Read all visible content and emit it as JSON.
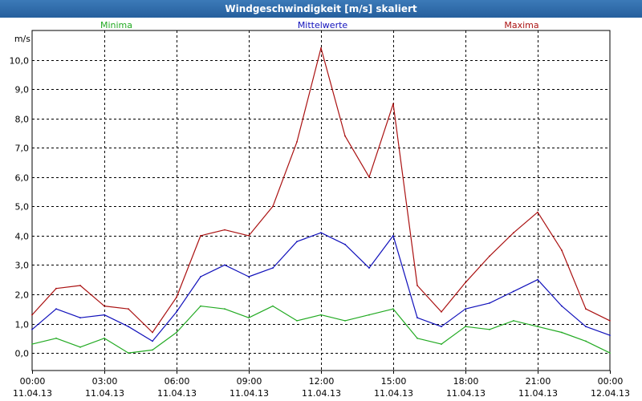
{
  "window": {
    "title": "Windgeschwindigkeit [m/s] skaliert"
  },
  "colors": {
    "minima": "#22aa22",
    "mittelwerte": "#1111bb",
    "maxima": "#aa1111",
    "grid": "#000000",
    "background": "#ffffff",
    "titlebar": "#2f6ca8"
  },
  "chart_data": {
    "type": "line",
    "title": "Windgeschwindigkeit [m/s] skaliert",
    "ylabel": "m/s",
    "xlabel": "",
    "ylim": [
      -0.6,
      11.0
    ],
    "xlim": [
      0,
      24
    ],
    "grid": true,
    "legend_position": "top",
    "yticks": [
      0.0,
      1.0,
      2.0,
      3.0,
      4.0,
      5.0,
      6.0,
      7.0,
      8.0,
      9.0,
      10.0
    ],
    "ytick_labels": [
      "0,0",
      "1,0",
      "2,0",
      "3,0",
      "4,0",
      "5,0",
      "6,0",
      "7,0",
      "8,0",
      "9,0",
      "10,0"
    ],
    "xticks": [
      0,
      3,
      6,
      9,
      12,
      15,
      18,
      21,
      24
    ],
    "xtick_labels": [
      {
        "time": "00:00",
        "date": "11.04.13"
      },
      {
        "time": "03:00",
        "date": "11.04.13"
      },
      {
        "time": "06:00",
        "date": "11.04.13"
      },
      {
        "time": "09:00",
        "date": "11.04.13"
      },
      {
        "time": "12:00",
        "date": "11.04.13"
      },
      {
        "time": "15:00",
        "date": "11.04.13"
      },
      {
        "time": "18:00",
        "date": "11.04.13"
      },
      {
        "time": "21:00",
        "date": "11.04.13"
      },
      {
        "time": "00:00",
        "date": "12.04.13"
      }
    ],
    "x": [
      0,
      1,
      2,
      3,
      4,
      5,
      6,
      7,
      8,
      9,
      10,
      11,
      12,
      13,
      14,
      15,
      16,
      17,
      18,
      19,
      20,
      21,
      22,
      23,
      24
    ],
    "series": [
      {
        "name": "Minima",
        "color": "#22aa22",
        "values": [
          0.3,
          0.5,
          0.2,
          0.5,
          0.0,
          0.1,
          0.7,
          1.6,
          1.5,
          1.2,
          1.6,
          1.1,
          1.3,
          1.1,
          1.3,
          1.5,
          0.5,
          0.3,
          0.9,
          0.8,
          1.1,
          0.9,
          0.7,
          0.4,
          0.0
        ]
      },
      {
        "name": "Mittelwerte",
        "color": "#1111bb",
        "values": [
          0.8,
          1.5,
          1.2,
          1.3,
          0.9,
          0.4,
          1.4,
          2.6,
          3.0,
          2.6,
          2.9,
          3.8,
          4.1,
          3.7,
          2.9,
          4.0,
          1.2,
          0.9,
          1.5,
          1.7,
          2.1,
          2.5,
          1.6,
          0.9,
          0.6
        ]
      },
      {
        "name": "Maxima",
        "color": "#aa1111",
        "values": [
          1.3,
          2.2,
          2.3,
          1.6,
          1.5,
          0.7,
          1.9,
          4.0,
          4.2,
          4.0,
          5.0,
          7.2,
          10.4,
          7.4,
          6.0,
          8.5,
          2.3,
          1.4,
          2.4,
          3.3,
          4.1,
          4.8,
          3.5,
          1.5,
          1.1
        ]
      }
    ]
  }
}
